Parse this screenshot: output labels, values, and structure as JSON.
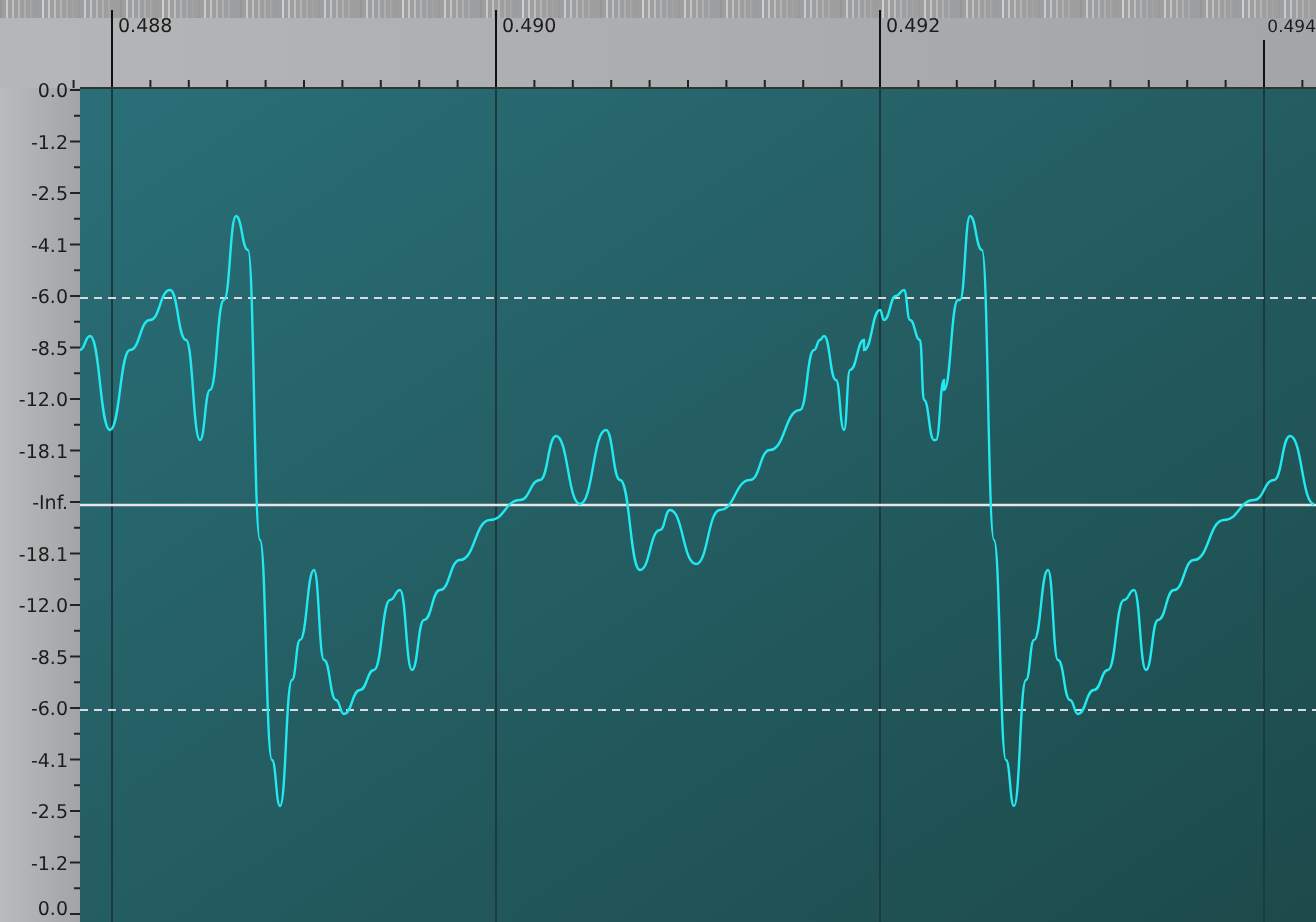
{
  "time_ruler": {
    "labels": [
      "0.488",
      "0.490",
      "0.492",
      "0.494"
    ]
  },
  "level_axis": {
    "labels": [
      "0.0",
      "-1.2",
      "-2.5",
      "-4.1",
      "-6.0",
      "-8.5",
      "-12.0",
      "-18.1",
      "-Inf.",
      "-18.1",
      "-12.0",
      "-8.5",
      "-6.0",
      "-4.1",
      "-2.5",
      "-1.2",
      "0.0"
    ]
  }
}
